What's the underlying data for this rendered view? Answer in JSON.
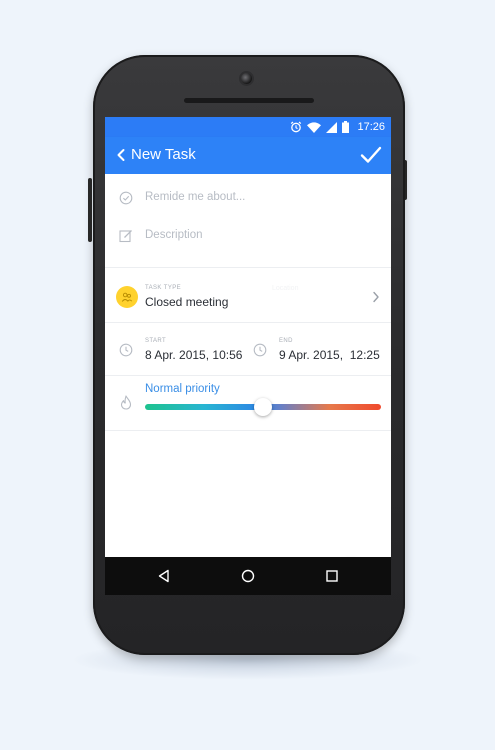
{
  "status_bar": {
    "time": "17:26",
    "icons": [
      "alarm-icon",
      "wifi-icon",
      "signal-icon",
      "battery-icon"
    ]
  },
  "app_bar": {
    "title": "New Task",
    "back_icon": "chevron-left-icon",
    "confirm_icon": "check-icon"
  },
  "form": {
    "reminder_placeholder": "Remide me about...",
    "description_placeholder": "Description",
    "task_type": {
      "label": "TASK TYPE",
      "value": "Closed meeting",
      "ghost": "Location"
    },
    "start": {
      "label": "START",
      "value": "8 Apr. 2015, 10:56"
    },
    "end": {
      "label": "END",
      "value": "9 Apr. 2015,  12:25"
    },
    "priority": {
      "label": "Normal priority",
      "level": 0.5
    }
  },
  "fab": {
    "icon": "paperclip-icon"
  },
  "nav_bar": {
    "icons": [
      "nav-back-icon",
      "nav-home-icon",
      "nav-recents-icon"
    ]
  },
  "colors": {
    "primary": "#2d82f7",
    "status_bar": "#2c7cf6",
    "accent_label": "#3a8ee6",
    "task_type_badge": "#ffd22e",
    "fab": "#2d7ff4"
  }
}
